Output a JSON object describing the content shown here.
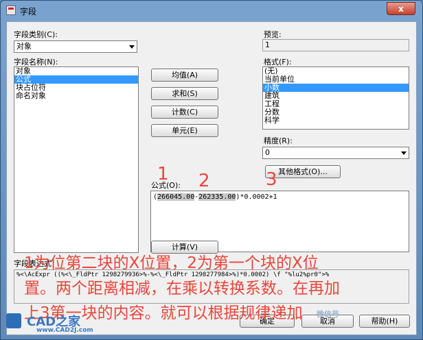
{
  "window": {
    "title": "字段",
    "close_glyph": "x"
  },
  "field_category": {
    "label": "字段类别(C):",
    "value": "对象"
  },
  "field_names": {
    "label": "字段名称(N):",
    "items": [
      "对象",
      "公式",
      "块占位符",
      "命名对象"
    ],
    "selected_index": 1
  },
  "buttons": {
    "average": "均值(A)",
    "sum": "求和(S)",
    "count": "计数(C)",
    "cell": "单元(E)",
    "other_format": "其他格式(O)...",
    "evaluate": "计算(V)",
    "ok": "确定",
    "cancel": "取消",
    "help": "帮助(H)"
  },
  "preview": {
    "label": "预览:",
    "value": "1"
  },
  "format": {
    "label": "格式(F):",
    "items": [
      "(无)",
      "当前单位",
      "小数",
      "建筑",
      "工程",
      "分数",
      "科学"
    ],
    "selected_index": 2
  },
  "precision": {
    "label": "精度(R):",
    "value": "0"
  },
  "formula": {
    "label": "公式(O):",
    "part1": "266045.00",
    "dash": "-",
    "part2": "262335.00",
    "rest": ")*0.0002+1",
    "open": "("
  },
  "field_expression": {
    "label": "字段表达式",
    "value": "%<\\AcExpr ((%<\\_FldPtr 1298279936>%-%<\\_FldPtr 1298277984>%)*0.0002) \\f \"%lu2%pr0\">%"
  },
  "annotations": {
    "n1": "1",
    "n2": "2",
    "n3": "3",
    "line1": "1为位第二块的X位置，2为第一个块的X位",
    "line2": "置。两个距离相减，在乘以转换系数。在再加",
    "line3": "上3第一块的内容。就可以根据规律递加"
  },
  "watermark": {
    "brand": "CAD之家",
    "url": "www.CAD2J.com",
    "wechat": "微信号"
  }
}
